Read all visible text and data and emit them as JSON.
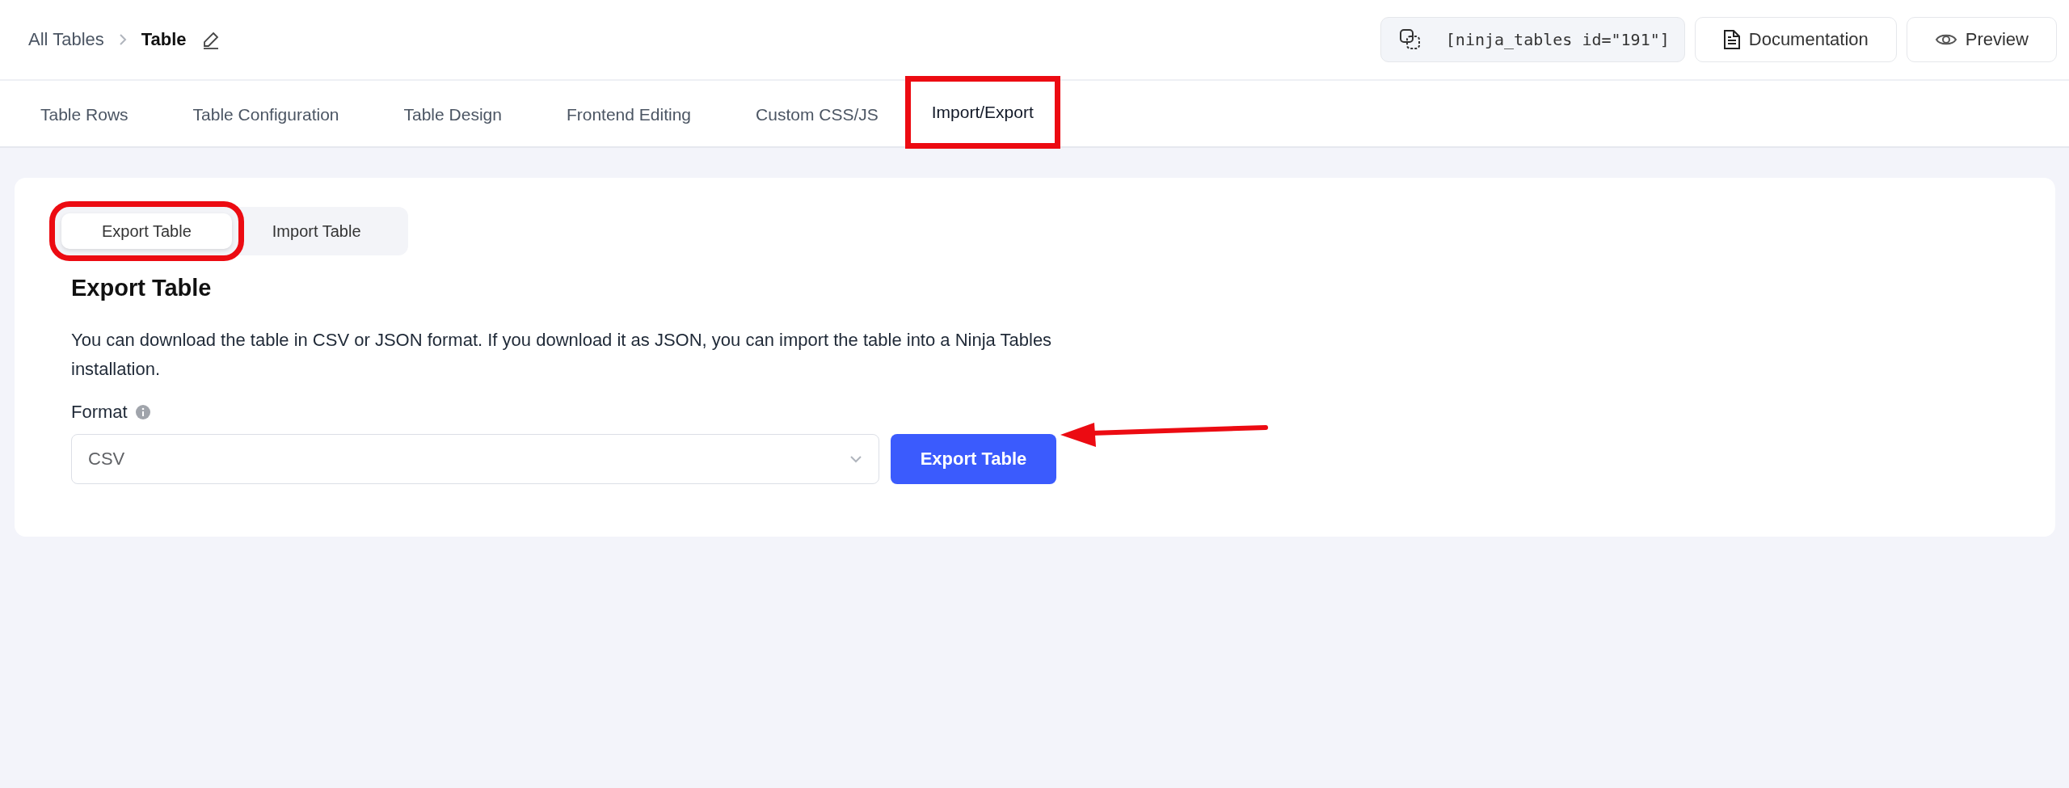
{
  "breadcrumb": {
    "parent": "All Tables",
    "current": "Table"
  },
  "shortcode": "[ninja_tables id=\"191\"]",
  "header_buttons": [
    {
      "label": "Documentation",
      "kind": "doc"
    },
    {
      "label": "Preview",
      "kind": "preview"
    }
  ],
  "tabs": [
    {
      "label": "Table Rows",
      "selected": false,
      "highlighted": false
    },
    {
      "label": "Table Configuration",
      "selected": false,
      "highlighted": false
    },
    {
      "label": "Table Design",
      "selected": false,
      "highlighted": false
    },
    {
      "label": "Frontend Editing",
      "selected": false,
      "highlighted": false
    },
    {
      "label": "Custom CSS/JS",
      "selected": false,
      "highlighted": false
    },
    {
      "label": "Import/Export",
      "selected": true,
      "highlighted": true
    }
  ],
  "export": {
    "subtabs": [
      {
        "label": "Export Table",
        "selected": true,
        "highlighted": true
      },
      {
        "label": "Import Table",
        "selected": false,
        "highlighted": false
      }
    ],
    "heading": "Export Table",
    "description": "You can download the table in CSV or JSON format. If you download it as JSON, you can import the table into a Ninja Tables installation.",
    "format_label": "Format",
    "format_value": "CSV",
    "button": "Export Table",
    "button_pointed": true
  }
}
